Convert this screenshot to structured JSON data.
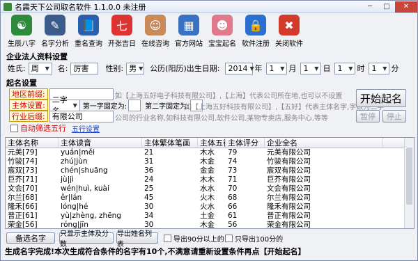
{
  "window": {
    "title": "名震天下公司取名软件 1.1.0.0 未注册"
  },
  "toolbar": [
    {
      "label": "生辰八字",
      "icon": "bagua-icon",
      "color": "#2e8b3d",
      "glyph": "☯"
    },
    {
      "label": "名字分析",
      "icon": "brush-icon",
      "color": "#3b5b8a",
      "glyph": "✎"
    },
    {
      "label": "重名查询",
      "icon": "book-icon",
      "color": "#2b5fae",
      "glyph": "📘"
    },
    {
      "label": "开张吉日",
      "icon": "calendar-icon",
      "color": "#d33",
      "glyph": "七"
    },
    {
      "label": "在线咨询",
      "icon": "operator-icon",
      "color": "#c98a5a",
      "glyph": "☺"
    },
    {
      "label": "官方网站",
      "icon": "building-icon",
      "color": "#3a72c2",
      "glyph": "▦"
    },
    {
      "label": "宝宝起名",
      "icon": "baby-icon",
      "color": "#e07a8a",
      "glyph": "☻"
    },
    {
      "label": "软件注册",
      "icon": "lock-icon",
      "color": "#2b6fd0",
      "glyph": "🔒"
    },
    {
      "label": "关闭软件",
      "icon": "close-circle-icon",
      "color": "#d23b2b",
      "glyph": "✖"
    }
  ],
  "corp": {
    "section": "企业法人资料设置",
    "surname_label": "姓氏:",
    "surname": "周",
    "name_label": "名:",
    "name": "厉害",
    "gender_label": "性别:",
    "gender": "男",
    "birth_label": "公历(阳历)出生日期:",
    "year": "2014",
    "year_unit": "年",
    "month": "1",
    "month_unit": "月",
    "day": "1",
    "day_unit": "日",
    "hour": "1",
    "hour_unit": "时",
    "minute": "1",
    "minute_unit": "分"
  },
  "naming": {
    "section": "起名设置",
    "region_label": "地区前缀:",
    "region_hint": "如【上海五好电子科技有限公司】,【上海】代表公司所在地,也可以不设置",
    "subject_label": "主体设置:",
    "subject_value": "二字名",
    "first_fixed_label": "第一字固定为:",
    "second_fixed_label": "第二字固定为:",
    "subject_hint": "如【上海五好科技有限公司】,【五好】代表主体名字,字数为二字",
    "industry_label": "行业后缀:",
    "industry_value": "有限公司",
    "industry_hint": "公司的行业名称,如科技有限公司,软件公司,某物专卖店,服务中心,等等",
    "auto_filter": "自动筛选五行",
    "five_elements_link": "五行设置",
    "start_button": "开始起名",
    "pause_button": "暂停",
    "stop_button": "停止"
  },
  "table": {
    "columns": [
      "主体名称",
      "主体读音",
      "主体繁体笔画",
      "主体五行",
      "主体评分",
      "企业全名"
    ],
    "rows": [
      [
        "元美[79]",
        "yuán|měi",
        "21",
        "木水",
        "79",
        "元美有限公司"
      ],
      [
        "竹骏[74]",
        "zhú|jùn",
        "31",
        "木金",
        "74",
        "竹骏有限公司"
      ],
      [
        "宸双[73]",
        "chén|shuāng",
        "36",
        "金金",
        "73",
        "宸双有限公司"
      ],
      [
        "巨芥[71]",
        "jù|jì",
        "24",
        "木木",
        "71",
        "巨芥有限公司"
      ],
      [
        "文会[70]",
        "wén|huì, kuài",
        "25",
        "水水",
        "70",
        "文会有限公司"
      ],
      [
        "尔兰[68]",
        "ěr|lán",
        "45",
        "火木",
        "68",
        "尔兰有限公司"
      ],
      [
        "隆禾[66]",
        "lóng|hé",
        "30",
        "火水",
        "66",
        "隆禾有限公司"
      ],
      [
        "普正[61]",
        "yù|zhèng, zhēng",
        "34",
        "土金",
        "61",
        "普正有限公司"
      ],
      [
        "荣金[56]",
        "róng|jīn",
        "30",
        "木金",
        "56",
        "荣金有限公司"
      ],
      [
        "杰廷[55]",
        "jié|tíng",
        "21",
        "木火",
        "55",
        "杰廷有限公司"
      ]
    ]
  },
  "bottom": {
    "backup_button": "备选名字",
    "show_subject_button": "只显示主体及分数",
    "export_button": "导出姓名列表",
    "export90": "导出90分以上的",
    "export100": "只导出100分的"
  },
  "status": "生成名字完成!本次生成符合条件的名字有10个,不满意请重新设置条件再点【开始起名】"
}
